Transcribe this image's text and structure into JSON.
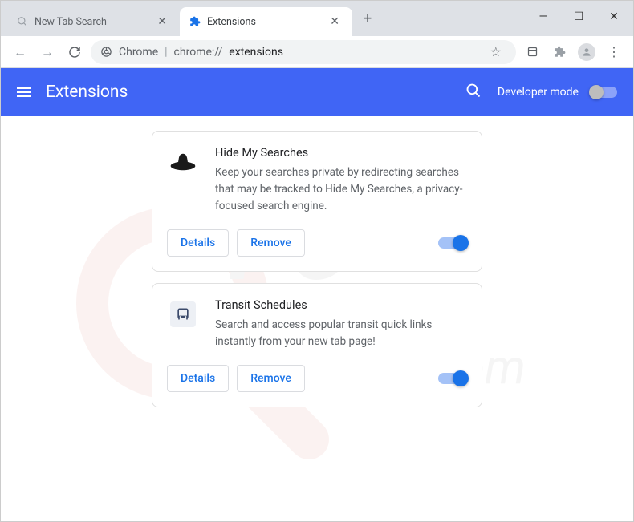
{
  "window": {
    "tabs": [
      {
        "title": "New Tab Search",
        "active": false
      },
      {
        "title": "Extensions",
        "active": true
      }
    ]
  },
  "addressbar": {
    "scheme": "Chrome",
    "url_prefix": "chrome://",
    "url_path": "extensions"
  },
  "header": {
    "title": "Extensions",
    "dev_mode_label": "Developer mode"
  },
  "extensions": [
    {
      "name": "Hide My Searches",
      "description": "Keep your searches private by redirecting searches that may be tracked to Hide My Searches, a privacy-focused search engine.",
      "details_label": "Details",
      "remove_label": "Remove",
      "enabled": true,
      "icon": "hat"
    },
    {
      "name": "Transit Schedules",
      "description": "Search and access popular transit quick links instantly from your new tab page!",
      "details_label": "Details",
      "remove_label": "Remove",
      "enabled": true,
      "icon": "bus"
    }
  ]
}
